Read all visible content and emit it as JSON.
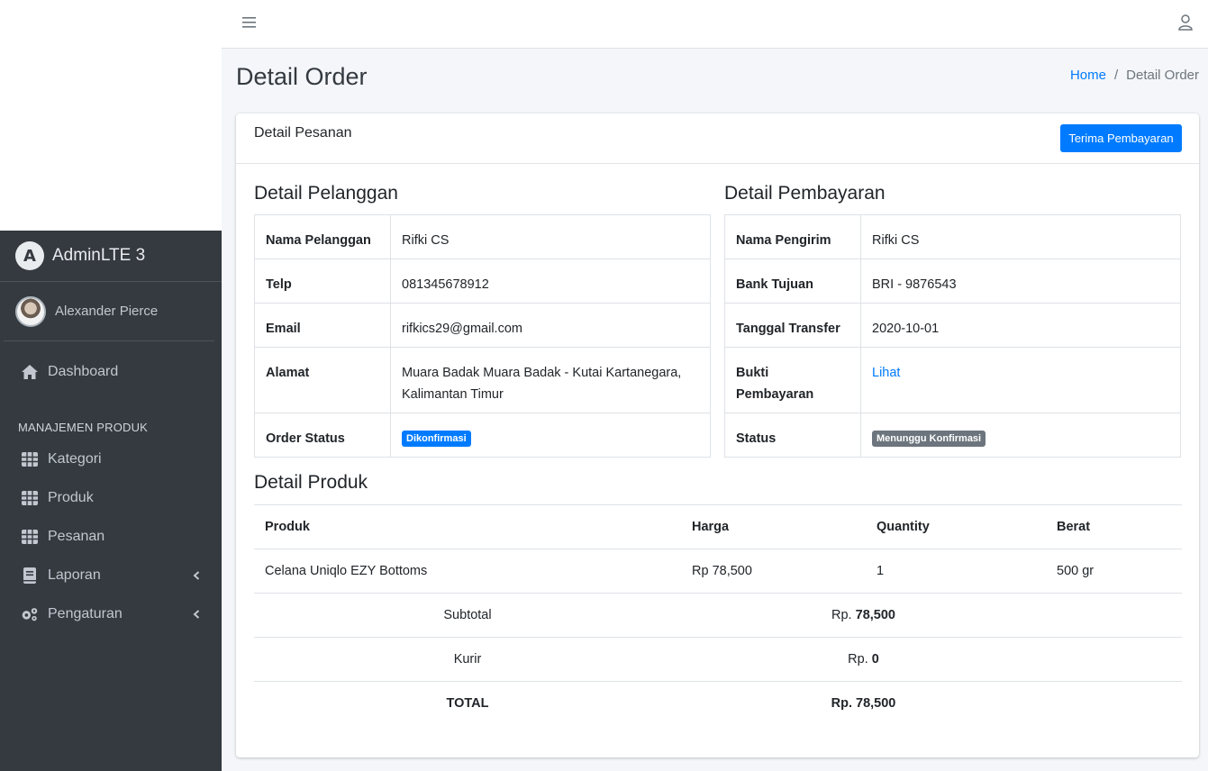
{
  "brand": {
    "name": "AdminLTE 3",
    "logo_letter": "A"
  },
  "user": {
    "name": "Alexander Pierce"
  },
  "sidebar": {
    "dashboard": "Dashboard",
    "section_header": "MANAJEMEN PRODUK",
    "items": [
      {
        "label": "Kategori",
        "icon": "table-icon"
      },
      {
        "label": "Produk",
        "icon": "table-icon"
      },
      {
        "label": "Pesanan",
        "icon": "table-icon"
      },
      {
        "label": "Laporan",
        "icon": "book-icon",
        "has_submenu": true
      },
      {
        "label": "Pengaturan",
        "icon": "cogs-icon",
        "has_submenu": true
      }
    ]
  },
  "page": {
    "title": "Detail Order"
  },
  "breadcrumb": {
    "home": "Home",
    "separator": "/",
    "current": "Detail Order"
  },
  "card": {
    "title": "Detail Pesanan",
    "action_button": "Terima Pembayaran"
  },
  "customer": {
    "section_title": "Detail Pelanggan",
    "name_label": "Nama Pelanggan",
    "name": "Rifki CS",
    "phone_label": "Telp",
    "phone": "081345678912",
    "email_label": "Email",
    "email": "rifkics29@gmail.com",
    "address_label": "Alamat",
    "address": "Muara Badak Muara Badak - Kutai Kartanegara, Kalimantan Timur",
    "status_label": "Order Status",
    "status": "Dikonfirmasi"
  },
  "payment": {
    "section_title": "Detail Pembayaran",
    "sender_label": "Nama Pengirim",
    "sender": "Rifki CS",
    "bank_label": "Bank Tujuan",
    "bank": "BRI - 9876543",
    "date_label": "Tanggal Transfer",
    "date": "2020-10-01",
    "proof_label": "Bukti Pembayaran",
    "proof_link": "Lihat",
    "status_label": "Status",
    "status": "Menunggu Konfirmasi"
  },
  "products": {
    "section_title": "Detail Produk",
    "headers": {
      "product": "Produk",
      "price": "Harga",
      "quantity": "Quantity",
      "weight": "Berat"
    },
    "rows": [
      {
        "product": "Celana Uniqlo EZY Bottoms",
        "price": "Rp 78,500",
        "quantity": "1",
        "weight": "500 gr"
      }
    ],
    "subtotal_label": "Subtotal",
    "subtotal_prefix": "Rp.",
    "subtotal_value": "78,500",
    "courier_label": "Kurir",
    "courier_prefix": "Rp.",
    "courier_value": "0",
    "total_label": "TOTAL",
    "total_value": "Rp. 78,500"
  },
  "colors": {
    "primary": "#007bff",
    "secondary": "#6c757d",
    "sidebar_bg": "#343a40"
  }
}
